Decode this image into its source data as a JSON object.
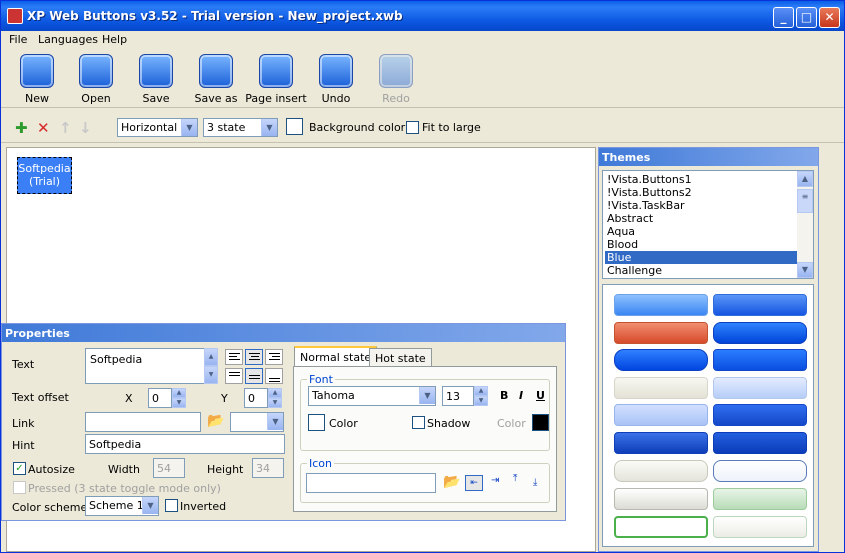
{
  "window": {
    "title": "XP Web Buttons v3.52 - Trial version - New_project.xwb"
  },
  "menu": [
    "File",
    "Languages",
    "Help"
  ],
  "toolbar": {
    "new": "New",
    "open": "Open",
    "save": "Save",
    "save_as": "Save as",
    "page_insert": "Page insert",
    "undo": "Undo",
    "redo": "Redo"
  },
  "toolbar2": {
    "orientation": "Horizontal",
    "state": "3 state",
    "background_color": "Background color",
    "fit_to_large": "Fit to large"
  },
  "preview": {
    "line1": "Softpedia",
    "line2": "(Trial)"
  },
  "themes": {
    "title": "Themes",
    "items": [
      "!Vista.Buttons1",
      "!Vista.Buttons2",
      "!Vista.TaskBar",
      "Abstract",
      "Aqua",
      "Blood",
      "Blue",
      "Challenge"
    ],
    "selected": "Blue"
  },
  "properties": {
    "title": "Properties",
    "text_label": "Text",
    "text_value": "Softpedia",
    "offset_label": "Text offset",
    "x_label": "X",
    "x_value": "0",
    "y_label": "Y",
    "y_value": "0",
    "link_label": "Link",
    "link_value": "",
    "hint_label": "Hint",
    "hint_value": "Softpedia",
    "autosize_label": "Autosize",
    "width_label": "Width",
    "width_value": "54",
    "height_label": "Height",
    "height_value": "34",
    "pressed_label": "Pressed (3 state toggle mode only)",
    "scheme_label": "Color scheme",
    "scheme_value": "Scheme 1",
    "inverted_label": "Inverted"
  },
  "tabs": {
    "normal": "Normal state",
    "hot": "Hot state",
    "font_group": "Font",
    "font_name": "Tahoma",
    "font_size": "13",
    "bold": "B",
    "italic": "I",
    "underline": "U",
    "color_label": "Color",
    "shadow_label": "Shadow",
    "color2_label": "Color",
    "icon_group": "Icon"
  },
  "colors": {
    "accent": "#316ac5",
    "title_bar": "#0b56e0"
  }
}
